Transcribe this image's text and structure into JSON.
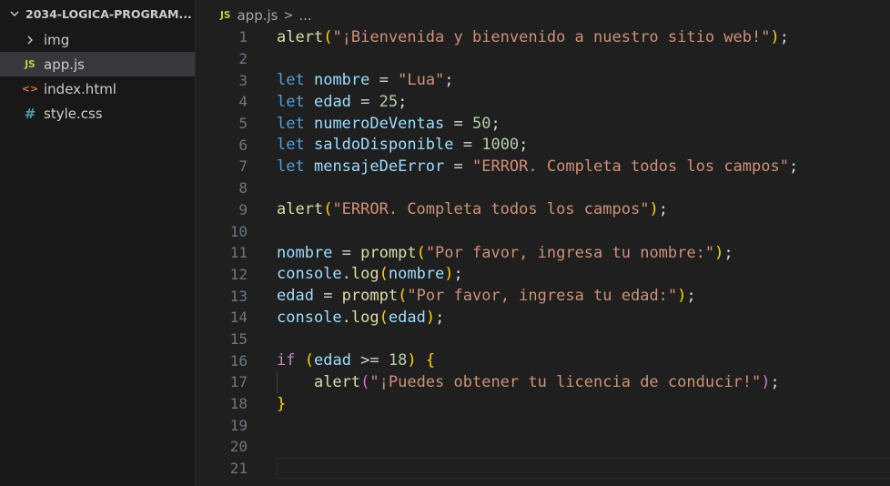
{
  "explorer": {
    "folder_name": "2034-LOGICA-PROGRAM...",
    "items": [
      {
        "label": "img",
        "icon": "chevron-right-icon"
      },
      {
        "label": "app.js",
        "icon": "js-file-icon",
        "badge": "JS"
      },
      {
        "label": "index.html",
        "icon": "html-file-icon",
        "badge": "<>"
      },
      {
        "label": "style.css",
        "icon": "css-file-icon",
        "badge": "#"
      }
    ]
  },
  "breadcrumb": {
    "badge": "JS",
    "file": "app.js",
    "separator": ">",
    "rest": "..."
  },
  "editor": {
    "line_numbers": [
      "1",
      "2",
      "3",
      "4",
      "5",
      "6",
      "7",
      "8",
      "9",
      "10",
      "11",
      "12",
      "13",
      "14",
      "15",
      "16",
      "17",
      "18",
      "19",
      "20",
      "21"
    ],
    "lines": [
      [
        [
          "fn",
          "alert"
        ],
        [
          "p1",
          "("
        ],
        [
          "str",
          "\"¡Bienvenida y bienvenido a nuestro sitio web!\""
        ],
        [
          "p1",
          ")"
        ],
        [
          "op",
          ";"
        ]
      ],
      [],
      [
        [
          "kw",
          "let"
        ],
        [
          "op",
          " "
        ],
        [
          "var",
          "nombre"
        ],
        [
          "op",
          " = "
        ],
        [
          "str",
          "\"Lua\""
        ],
        [
          "op",
          ";"
        ]
      ],
      [
        [
          "kw",
          "let"
        ],
        [
          "op",
          " "
        ],
        [
          "var",
          "edad"
        ],
        [
          "op",
          " = "
        ],
        [
          "num",
          "25"
        ],
        [
          "op",
          ";"
        ]
      ],
      [
        [
          "kw",
          "let"
        ],
        [
          "op",
          " "
        ],
        [
          "var",
          "numeroDeVentas"
        ],
        [
          "op",
          " = "
        ],
        [
          "num",
          "50"
        ],
        [
          "op",
          ";"
        ]
      ],
      [
        [
          "kw",
          "let"
        ],
        [
          "op",
          " "
        ],
        [
          "var",
          "saldoDisponible"
        ],
        [
          "op",
          " = "
        ],
        [
          "num",
          "1000"
        ],
        [
          "op",
          ";"
        ]
      ],
      [
        [
          "kw",
          "let"
        ],
        [
          "op",
          " "
        ],
        [
          "var",
          "mensajeDeError"
        ],
        [
          "op",
          " = "
        ],
        [
          "str",
          "\"ERROR. Completa todos los campos\""
        ],
        [
          "op",
          ";"
        ]
      ],
      [],
      [
        [
          "fn",
          "alert"
        ],
        [
          "p1",
          "("
        ],
        [
          "str",
          "\"ERROR. Completa todos los campos\""
        ],
        [
          "p1",
          ")"
        ],
        [
          "op",
          ";"
        ]
      ],
      [],
      [
        [
          "var",
          "nombre"
        ],
        [
          "op",
          " = "
        ],
        [
          "fn",
          "prompt"
        ],
        [
          "p1",
          "("
        ],
        [
          "str",
          "\"Por favor, ingresa tu nombre:\""
        ],
        [
          "p1",
          ")"
        ],
        [
          "op",
          ";"
        ]
      ],
      [
        [
          "var",
          "console"
        ],
        [
          "op",
          "."
        ],
        [
          "fn",
          "log"
        ],
        [
          "p1",
          "("
        ],
        [
          "var",
          "nombre"
        ],
        [
          "p1",
          ")"
        ],
        [
          "op",
          ";"
        ]
      ],
      [
        [
          "var",
          "edad"
        ],
        [
          "op",
          " = "
        ],
        [
          "fn",
          "prompt"
        ],
        [
          "p1",
          "("
        ],
        [
          "str",
          "\"Por favor, ingresa tu edad:\""
        ],
        [
          "p1",
          ")"
        ],
        [
          "op",
          ";"
        ]
      ],
      [
        [
          "var",
          "console"
        ],
        [
          "op",
          "."
        ],
        [
          "fn",
          "log"
        ],
        [
          "p1",
          "("
        ],
        [
          "var",
          "edad"
        ],
        [
          "p1",
          ")"
        ],
        [
          "op",
          ";"
        ]
      ],
      [],
      [
        [
          "ctl",
          "if"
        ],
        [
          "op",
          " "
        ],
        [
          "p1",
          "("
        ],
        [
          "var",
          "edad"
        ],
        [
          "op",
          " >= "
        ],
        [
          "num",
          "18"
        ],
        [
          "p1",
          ")"
        ],
        [
          "op",
          " "
        ],
        [
          "p1",
          "{"
        ]
      ],
      [
        [
          "op",
          "    "
        ],
        [
          "fn",
          "alert"
        ],
        [
          "p2",
          "("
        ],
        [
          "str",
          "\"¡Puedes obtener tu licencia de conducir!\""
        ],
        [
          "p2",
          ")"
        ],
        [
          "op",
          ";"
        ]
      ],
      [
        [
          "p1",
          "}"
        ]
      ],
      [],
      [],
      []
    ]
  }
}
